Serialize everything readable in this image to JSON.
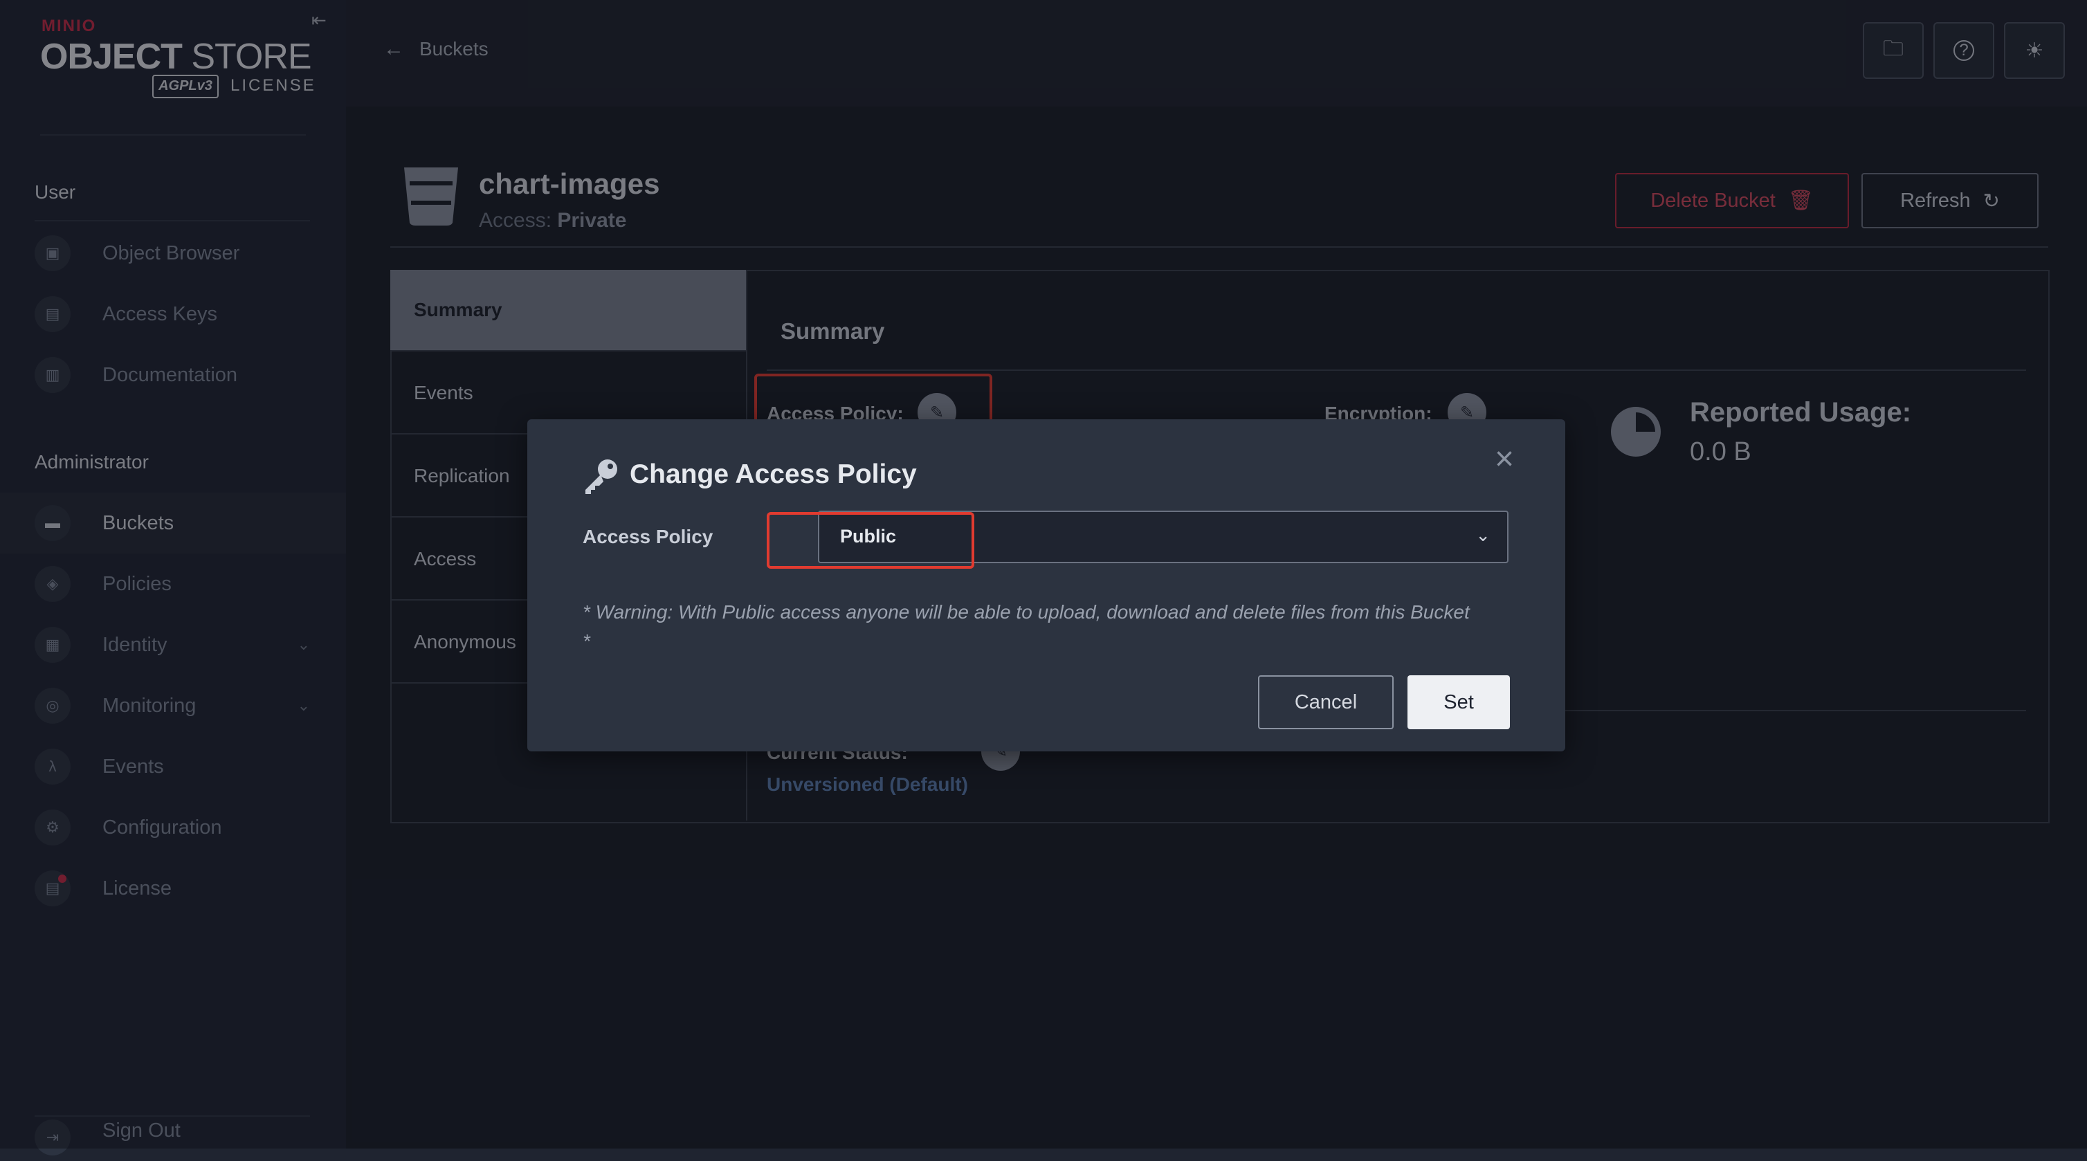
{
  "sidebar": {
    "logo": {
      "brand": "MINIO",
      "product_bold": "OBJECT",
      "product": "STORE",
      "agpl": "AGPLv3",
      "license": "LICENSE"
    },
    "user_section": "User",
    "user_items": [
      {
        "label": "Object Browser",
        "icon": "object-browser-icon"
      },
      {
        "label": "Access Keys",
        "icon": "access-keys-icon"
      },
      {
        "label": "Documentation",
        "icon": "documentation-icon"
      }
    ],
    "admin_section": "Administrator",
    "admin_items": [
      {
        "label": "Buckets",
        "icon": "bucket-icon",
        "active": true
      },
      {
        "label": "Policies",
        "icon": "policies-icon"
      },
      {
        "label": "Identity",
        "icon": "identity-icon",
        "expandable": true
      },
      {
        "label": "Monitoring",
        "icon": "monitoring-icon",
        "expandable": true
      },
      {
        "label": "Events",
        "icon": "lambda-icon"
      },
      {
        "label": "Configuration",
        "icon": "gear-icon"
      },
      {
        "label": "License",
        "icon": "license-icon"
      }
    ],
    "sign_out": "Sign Out"
  },
  "header": {
    "back_label": "Buckets",
    "actions": [
      "folder-icon",
      "help-icon",
      "theme-sun-icon"
    ]
  },
  "bucket": {
    "name": "chart-images",
    "access_prefix": "Access: ",
    "access_value": "Private",
    "delete_label": "Delete Bucket",
    "refresh_label": "Refresh"
  },
  "tabs": [
    "Summary",
    "Events",
    "Replication",
    "Access",
    "Anonymous"
  ],
  "summary": {
    "title": "Summary",
    "access_policy_label": "Access Policy:",
    "encryption_label": "Encryption:",
    "reported_usage_label": "Reported Usage:",
    "reported_usage_value": "0.0 B",
    "current_status_label": "Current Status:",
    "versioning_value": "Unversioned (Default)"
  },
  "modal": {
    "title": "Change Access Policy",
    "field_label": "Access Policy",
    "selected_value": "Public",
    "warning": "* Warning: With Public access anyone will be able to upload, download and delete files from this Bucket *",
    "cancel_label": "Cancel",
    "set_label": "Set"
  },
  "colors": {
    "accent_red": "#c72c48",
    "highlight": "#e13b30",
    "link_blue": "#5b7fb0"
  }
}
